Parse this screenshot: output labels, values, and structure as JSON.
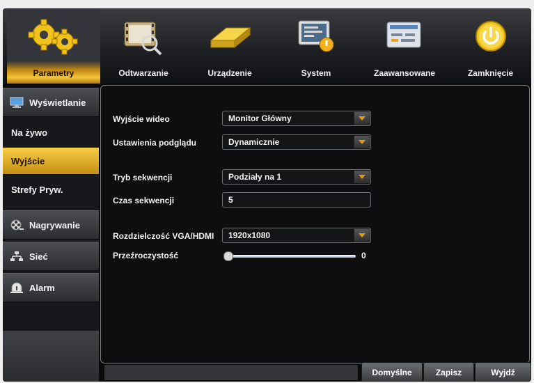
{
  "top_menu": [
    {
      "label": "Parametry",
      "icon": "gears-icon",
      "active": true
    },
    {
      "label": "Odtwarzanie",
      "icon": "playback-search-icon",
      "active": false
    },
    {
      "label": "Urządzenie",
      "icon": "hard-drive-icon",
      "active": false
    },
    {
      "label": "System",
      "icon": "system-info-icon",
      "active": false
    },
    {
      "label": "Zaawansowane",
      "icon": "advanced-icon",
      "active": false
    },
    {
      "label": "Zamknięcie",
      "icon": "power-icon",
      "active": false
    }
  ],
  "sidebar": {
    "items": [
      {
        "label": "Wyświetlanie",
        "type": "category",
        "icon": "monitor-icon"
      },
      {
        "label": "Na żywo",
        "type": "sub"
      },
      {
        "label": "Wyjście",
        "type": "sub",
        "selected": true
      },
      {
        "label": "Strefy Pryw.",
        "type": "sub"
      },
      {
        "label": "Nagrywanie",
        "type": "category",
        "icon": "film-reel-icon"
      },
      {
        "label": "Sieć",
        "type": "category",
        "icon": "network-icon"
      },
      {
        "label": "Alarm",
        "type": "category",
        "icon": "alarm-bell-icon"
      }
    ]
  },
  "settings": {
    "video_output": {
      "label": "Wyjście wideo",
      "value": "Monitor Główny"
    },
    "preview_settings": {
      "label": "Ustawienia podglądu",
      "value": "Dynamicznie"
    },
    "sequence_mode": {
      "label": "Tryb sekwencji",
      "value": "Podziały na 1"
    },
    "sequence_time": {
      "label": "Czas sekwencji",
      "value": "5"
    },
    "resolution": {
      "label": "Rozdzielczość VGA/HDMI",
      "value": "1920x1080"
    },
    "transparency": {
      "label": "Przeźroczystość",
      "value": "0",
      "level": 0
    }
  },
  "buttons": {
    "default": "Domyślne",
    "save": "Zapisz",
    "exit": "Wyjdź"
  },
  "colors": {
    "accent": "#f3c43a",
    "dropdown_arrow": "#e39a18"
  }
}
